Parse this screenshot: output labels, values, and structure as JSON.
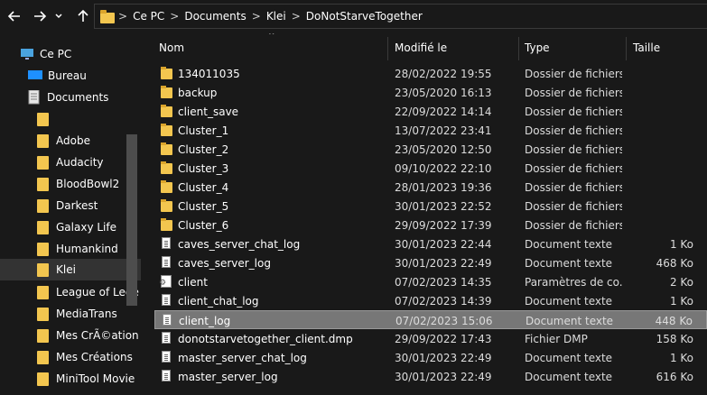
{
  "address_bar": {
    "crumbs": [
      "Ce PC",
      "Documents",
      "Klei",
      "DoNotStarveTogether"
    ],
    "separator": ">"
  },
  "sidebar": {
    "items": [
      {
        "label": "Ce PC",
        "icon": "pc-icon"
      },
      {
        "label": "Bureau",
        "icon": "desktop-icon"
      },
      {
        "label": "Documents",
        "icon": "documents-icon"
      },
      {
        "label": "",
        "icon": "folder-icon"
      },
      {
        "label": "Adobe",
        "icon": "folder-icon"
      },
      {
        "label": "Audacity",
        "icon": "folder-icon"
      },
      {
        "label": "BloodBowl2",
        "icon": "folder-icon"
      },
      {
        "label": "Darkest",
        "icon": "folder-icon"
      },
      {
        "label": "Galaxy Life",
        "icon": "folder-icon"
      },
      {
        "label": "Humankind",
        "icon": "folder-icon"
      },
      {
        "label": "Klei",
        "icon": "folder-icon",
        "selected": true
      },
      {
        "label": "League of Lege",
        "icon": "folder-icon"
      },
      {
        "label": "MediaTrans",
        "icon": "folder-icon"
      },
      {
        "label": "Mes CrÃ©ation",
        "icon": "folder-icon"
      },
      {
        "label": "Mes Créations",
        "icon": "folder-icon"
      },
      {
        "label": "MiniTool Movie",
        "icon": "folder-icon"
      }
    ]
  },
  "columns": {
    "name": "Nom",
    "date": "Modifié le",
    "type": "Type",
    "size": "Taille"
  },
  "files": [
    {
      "name": "134011035",
      "date": "28/02/2022 19:55",
      "type": "Dossier de fichiers",
      "size": "",
      "icon": "folder-icon"
    },
    {
      "name": "backup",
      "date": "23/05/2020 16:13",
      "type": "Dossier de fichiers",
      "size": "",
      "icon": "folder-icon"
    },
    {
      "name": "client_save",
      "date": "22/09/2022 14:14",
      "type": "Dossier de fichiers",
      "size": "",
      "icon": "folder-icon"
    },
    {
      "name": "Cluster_1",
      "date": "13/07/2022 23:41",
      "type": "Dossier de fichiers",
      "size": "",
      "icon": "folder-icon"
    },
    {
      "name": "Cluster_2",
      "date": "23/05/2020 12:50",
      "type": "Dossier de fichiers",
      "size": "",
      "icon": "folder-icon"
    },
    {
      "name": "Cluster_3",
      "date": "09/10/2022 22:10",
      "type": "Dossier de fichiers",
      "size": "",
      "icon": "folder-icon"
    },
    {
      "name": "Cluster_4",
      "date": "28/01/2023 19:36",
      "type": "Dossier de fichiers",
      "size": "",
      "icon": "folder-icon"
    },
    {
      "name": "Cluster_5",
      "date": "30/01/2023 22:52",
      "type": "Dossier de fichiers",
      "size": "",
      "icon": "folder-icon"
    },
    {
      "name": "Cluster_6",
      "date": "29/09/2022 17:39",
      "type": "Dossier de fichiers",
      "size": "",
      "icon": "folder-icon"
    },
    {
      "name": "caves_server_chat_log",
      "date": "30/01/2023 22:44",
      "type": "Document texte",
      "size": "1 Ko",
      "icon": "text-file-icon"
    },
    {
      "name": "caves_server_log",
      "date": "30/01/2023 22:49",
      "type": "Document texte",
      "size": "468 Ko",
      "icon": "text-file-icon"
    },
    {
      "name": "client",
      "date": "07/02/2023 14:35",
      "type": "Paramètres de co...",
      "size": "2 Ko",
      "icon": "settings-file-icon"
    },
    {
      "name": "client_chat_log",
      "date": "07/02/2023 14:39",
      "type": "Document texte",
      "size": "1 Ko",
      "icon": "text-file-icon"
    },
    {
      "name": "client_log",
      "date": "07/02/2023 15:06",
      "type": "Document texte",
      "size": "448 Ko",
      "icon": "text-file-icon",
      "selected": true
    },
    {
      "name": "donotstarvetogether_client.dmp",
      "date": "29/09/2022 17:43",
      "type": "Fichier DMP",
      "size": "158 Ko",
      "icon": "dmp-file-icon"
    },
    {
      "name": "master_server_chat_log",
      "date": "30/01/2023 22:49",
      "type": "Document texte",
      "size": "1 Ko",
      "icon": "text-file-icon"
    },
    {
      "name": "master_server_log",
      "date": "30/01/2023 22:49",
      "type": "Document texte",
      "size": "616 Ko",
      "icon": "text-file-icon"
    }
  ],
  "colors": {
    "background": "#191919",
    "selection": "#777777",
    "folder": "#f3c64f"
  }
}
